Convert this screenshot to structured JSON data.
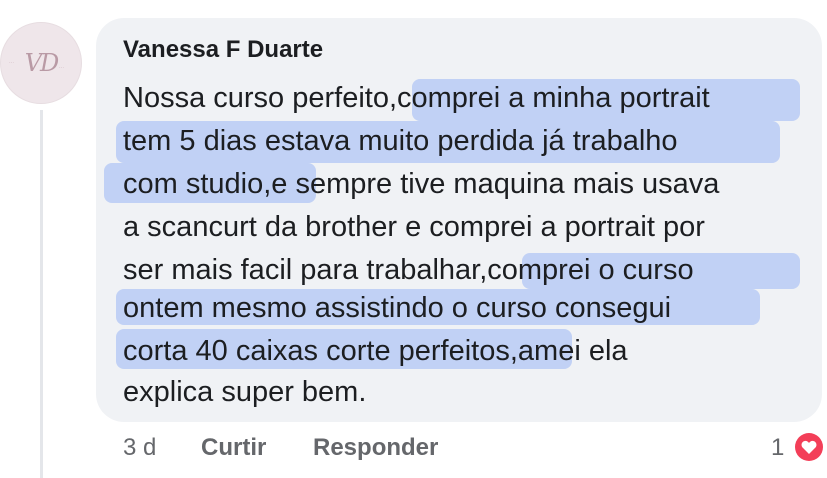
{
  "comment": {
    "author": "Vanessa F Duarte",
    "avatar": {
      "icon": "avatar-logo-icon",
      "monogram": "VD"
    },
    "lines": [
      "Nossa curso perfeito,comprei a minha portrait",
      "tem 5 dias estava muito perdida já trabalho",
      "com studio,e sempre tive maquina mais usava",
      "a scancurt da brother e comprei a portrait por",
      "ser mais facil para trabalhar,comprei o curso",
      "ontem mesmo assistindo o curso  consegui",
      "corta 40 caixas corte perfeitos,amei ela",
      "explica super bem."
    ],
    "highlight_color": "#b9cbf4"
  },
  "actions": {
    "timestamp": "3 d",
    "like_label": "Curtir",
    "reply_label": "Responder"
  },
  "reactions": {
    "count": "1",
    "icon": "heart-reaction-icon",
    "color": "#f33e58"
  }
}
